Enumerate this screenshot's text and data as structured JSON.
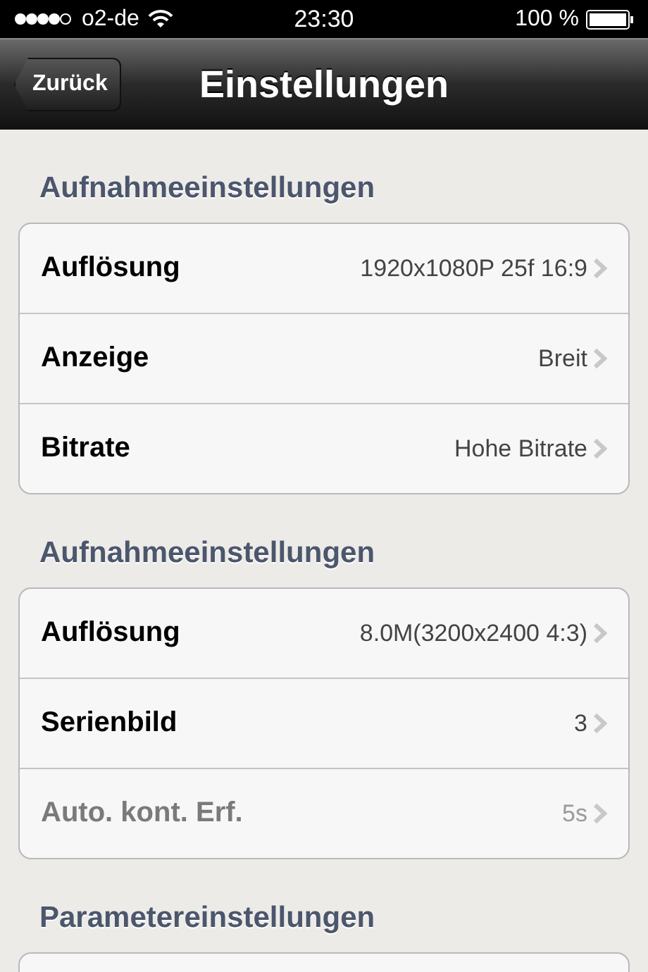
{
  "status_bar": {
    "carrier": "o2-de",
    "time": "23:30",
    "battery": "100 %"
  },
  "nav_bar": {
    "back": "Zurück",
    "title": "Einstellungen"
  },
  "sections": [
    {
      "header": "Aufnahmeeinstellungen",
      "rows": [
        {
          "label": "Auflösung",
          "value": "1920x1080P 25f 16:9",
          "disabled": false
        },
        {
          "label": "Anzeige",
          "value": "Breit",
          "disabled": false
        },
        {
          "label": "Bitrate",
          "value": "Hohe Bitrate",
          "disabled": false
        }
      ]
    },
    {
      "header": "Aufnahmeeinstellungen",
      "rows": [
        {
          "label": "Auflösung",
          "value": "8.0M(3200x2400 4:3)",
          "disabled": false
        },
        {
          "label": "Serienbild",
          "value": "3",
          "disabled": false
        },
        {
          "label": "Auto. kont. Erf.",
          "value": "5s",
          "disabled": true
        }
      ]
    },
    {
      "header": "Parametereinstellungen"
    }
  ]
}
